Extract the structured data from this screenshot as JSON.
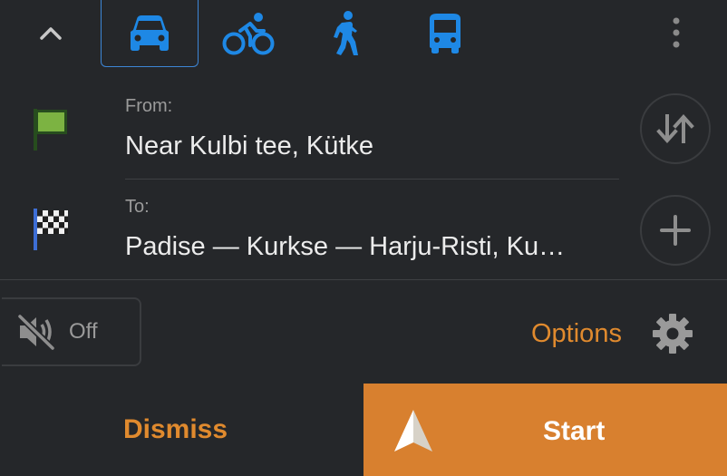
{
  "modes": [
    {
      "name": "car-icon",
      "selected": true
    },
    {
      "name": "bicycle-icon",
      "selected": false
    },
    {
      "name": "pedestrian-icon",
      "selected": false
    },
    {
      "name": "bus-icon",
      "selected": false
    }
  ],
  "route": {
    "from_label": "From:",
    "from_value": "Near Kulbi tee, Kütke",
    "to_label": "To:",
    "to_value": "Padise — Kurkse — Harju-Risti, Ku…"
  },
  "sound": {
    "label": "Off",
    "icon": "sound-off-icon"
  },
  "options": {
    "label": "Options",
    "icon": "gear-icon"
  },
  "actions": {
    "dismiss": "Dismiss",
    "start": "Start"
  },
  "colors": {
    "background": "#25272a",
    "accent_orange": "#e08a2e",
    "start_background": "#d8802f",
    "mode_blue": "#1e88e5",
    "flag_green": "#7cb342"
  }
}
